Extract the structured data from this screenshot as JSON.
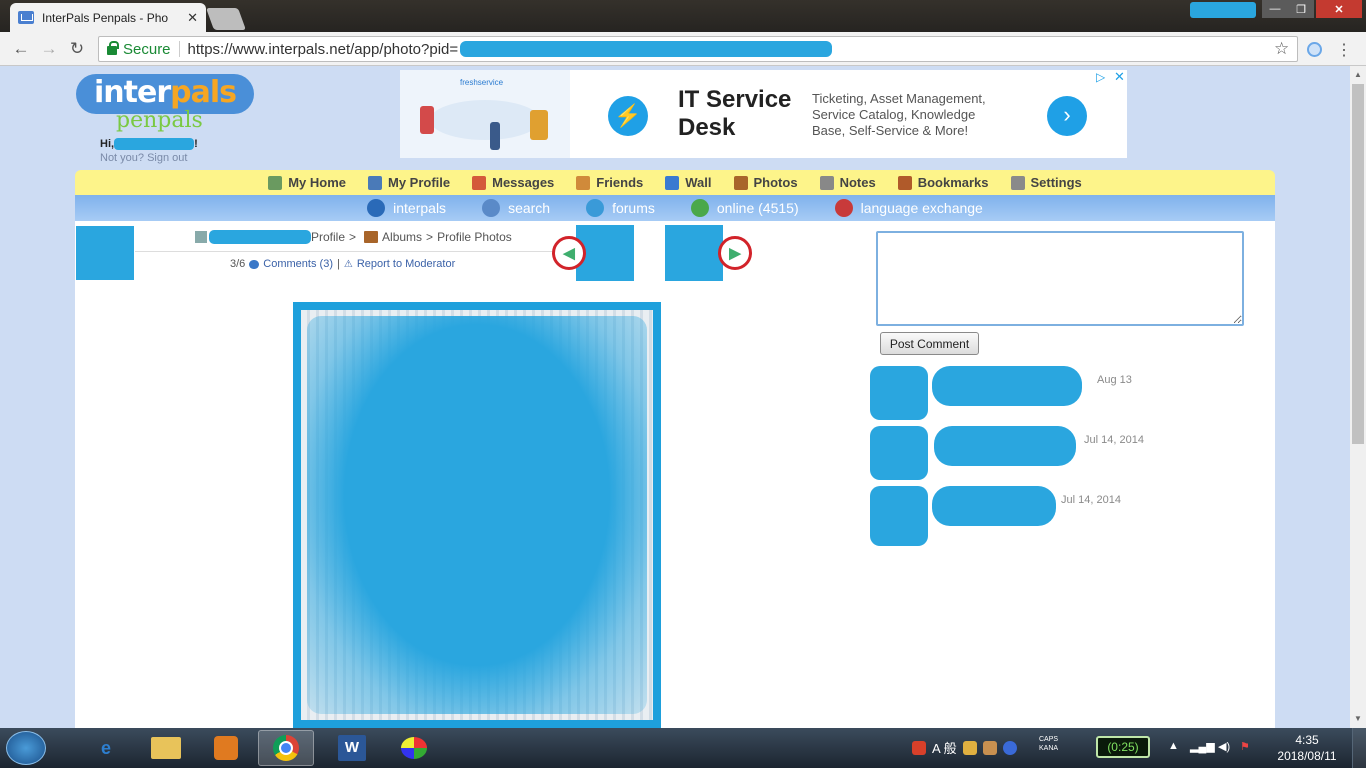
{
  "browser": {
    "tab_title": "InterPals Penpals - Pho",
    "secure_label": "Secure",
    "url": "https://www.interpals.net/app/photo?pid="
  },
  "site": {
    "logo_top": "inter",
    "logo_mid": "pals",
    "logo_bottom": "penpals",
    "greeting": "Hi,",
    "greeting_end": "!",
    "signout": "Not you? Sign out"
  },
  "ad": {
    "brand": "freshservice",
    "title": "IT Service Desk",
    "description": "Ticketing, Asset Management, Service Catalog, Knowledge Base, Self-Service & More!"
  },
  "nav_primary": [
    {
      "label": "My Home",
      "icon": "home-icon",
      "color": "#6a9a60"
    },
    {
      "label": "My Profile",
      "icon": "profile-icon",
      "color": "#4a7ab8"
    },
    {
      "label": "Messages",
      "icon": "envelope-icon",
      "color": "#d45a3a"
    },
    {
      "label": "Friends",
      "icon": "friends-icon",
      "color": "#d08a3a"
    },
    {
      "label": "Wall",
      "icon": "wall-icon",
      "color": "#3a7ad0"
    },
    {
      "label": "Photos",
      "icon": "photos-icon",
      "color": "#a8652a"
    },
    {
      "label": "Notes",
      "icon": "notes-icon",
      "color": "#888888"
    },
    {
      "label": "Bookmarks",
      "icon": "bookmarks-icon",
      "color": "#b05a2a"
    },
    {
      "label": "Settings",
      "icon": "settings-icon",
      "color": "#8a8a8a"
    }
  ],
  "nav_secondary": [
    {
      "label": "interpals",
      "icon": "globe-icon",
      "color": "#2a6ab8"
    },
    {
      "label": "search",
      "icon": "search-icon",
      "color": "#5a8ac8"
    },
    {
      "label": "forums",
      "icon": "forum-icon",
      "color": "#3a9ad8"
    },
    {
      "label": "online (4515)",
      "icon": "online-user-icon",
      "color": "#4aa84a"
    },
    {
      "label": "language exchange",
      "icon": "flags-icon",
      "color": "#c83a3a"
    }
  ],
  "photo_page": {
    "breadcrumb_profile": "Profile",
    "breadcrumb_sep": ">",
    "breadcrumb_albums": "Albums",
    "breadcrumb_current": "Profile Photos",
    "counter": "3/6",
    "comments_link": "Comments (3)",
    "divider": "|",
    "report_link": "Report to Moderator"
  },
  "comments": {
    "post_button": "Post Comment",
    "items": [
      {
        "date": "Aug 13"
      },
      {
        "date": "Jul 14, 2014"
      },
      {
        "date": "Jul 14, 2014"
      }
    ]
  },
  "taskbar": {
    "ime": "A 般",
    "caps": "CAPS",
    "kana": "KANA",
    "battery": "(0:25)",
    "time": "4:35",
    "date": "2018/08/11"
  },
  "colors": {
    "accent_blue": "#2aa6df",
    "nav_yellow": "#fdf48a",
    "nav_circle_red": "#d2232a"
  }
}
